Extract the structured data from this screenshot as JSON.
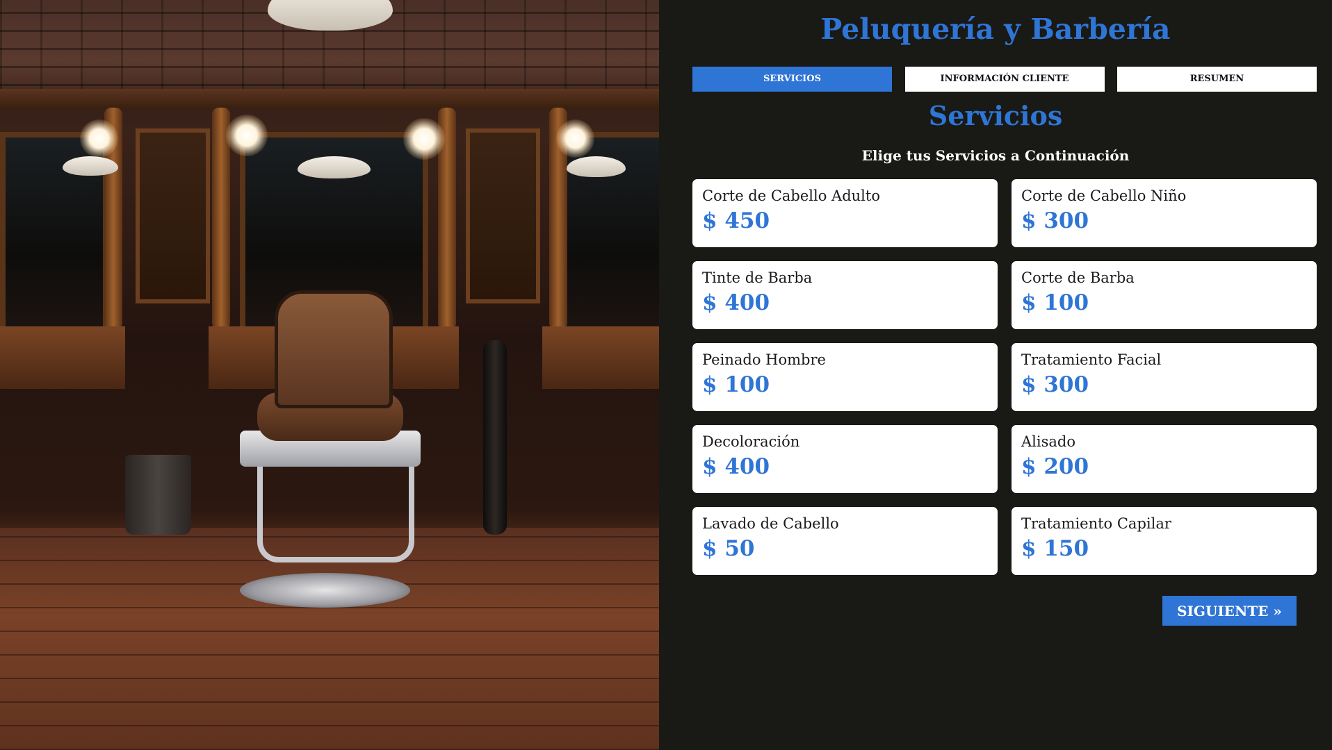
{
  "app": {
    "title": "Peluquería y Barbería",
    "accent_color": "#2f75d6",
    "background_color": "#191915"
  },
  "hero_image": {
    "icon": "barbershop-photo"
  },
  "steps": [
    {
      "label": "Servicios",
      "active": true
    },
    {
      "label": "Información Cliente",
      "active": false
    },
    {
      "label": "Resumen",
      "active": false
    }
  ],
  "section": {
    "title": "Servicios",
    "subtitle": "Elige tus Servicios a Continuación"
  },
  "services": [
    {
      "name": "Corte de Cabello Adulto",
      "price": "$ 450"
    },
    {
      "name": "Corte de Cabello Niño",
      "price": "$ 300"
    },
    {
      "name": "Tinte de Barba",
      "price": "$ 400"
    },
    {
      "name": "Corte de Barba",
      "price": "$ 100"
    },
    {
      "name": "Peinado Hombre",
      "price": "$ 100"
    },
    {
      "name": "Tratamiento Facial",
      "price": "$ 300"
    },
    {
      "name": "Decoloración",
      "price": "$ 400"
    },
    {
      "name": "Alisado",
      "price": "$ 200"
    },
    {
      "name": "Lavado de Cabello",
      "price": "$ 50"
    },
    {
      "name": "Tratamiento Capilar",
      "price": "$ 150"
    }
  ],
  "navigation": {
    "next_label": "Siguiente »"
  }
}
